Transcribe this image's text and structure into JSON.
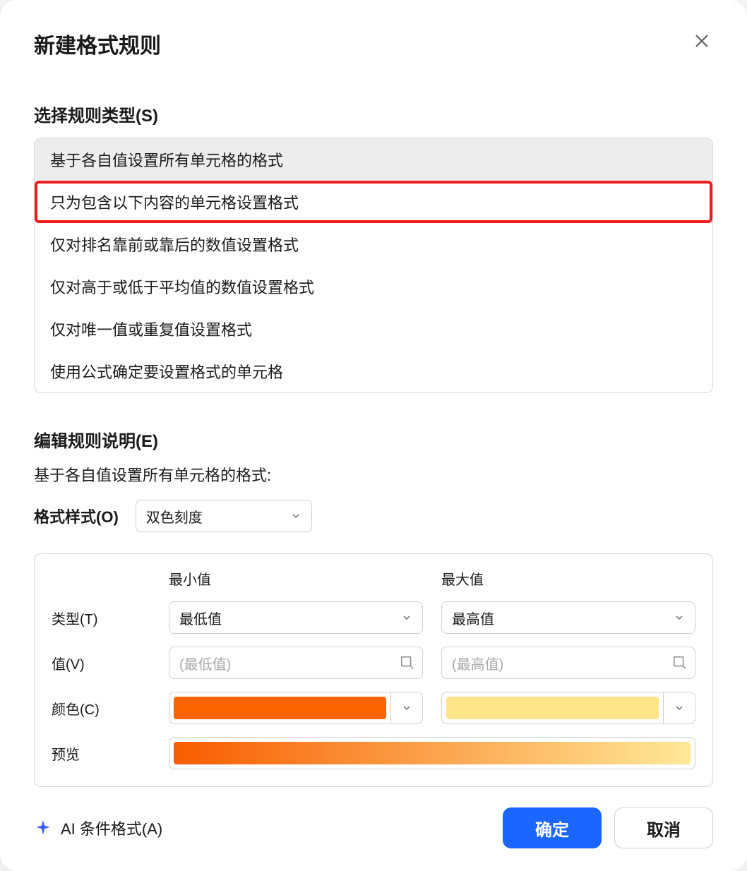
{
  "dialog": {
    "title": "新建格式规则",
    "ruleTypeLabel": "选择规则类型(S)",
    "ruleTypes": [
      "基于各自值设置所有单元格的格式",
      "只为包含以下内容的单元格设置格式",
      "仅对排名靠前或靠后的数值设置格式",
      "仅对高于或低于平均值的数值设置格式",
      "仅对唯一值或重复值设置格式",
      "使用公式确定要设置格式的单元格"
    ],
    "editRuleLabel": "编辑规则说明(E)",
    "ruleDesc": "基于各自值设置所有单元格的格式:",
    "formatStyleLabel": "格式样式(O)",
    "formatStyleValue": "双色刻度",
    "grid": {
      "minHeader": "最小值",
      "maxHeader": "最大值",
      "typeLabel": "类型(T)",
      "valueLabel": "值(V)",
      "colorLabel": "颜色(C)",
      "previewLabel": "预览",
      "minType": "最低值",
      "maxType": "最高值",
      "minValuePlaceholder": "(最低值)",
      "maxValuePlaceholder": "(最高值)",
      "minColor": "#fa6400",
      "maxColor": "#ffe58a",
      "gradFrom": "#f85c00",
      "gradTo": "#ffe999"
    },
    "aiLinkLabel": "AI 条件格式(A)",
    "okLabel": "确定",
    "cancelLabel": "取消"
  }
}
